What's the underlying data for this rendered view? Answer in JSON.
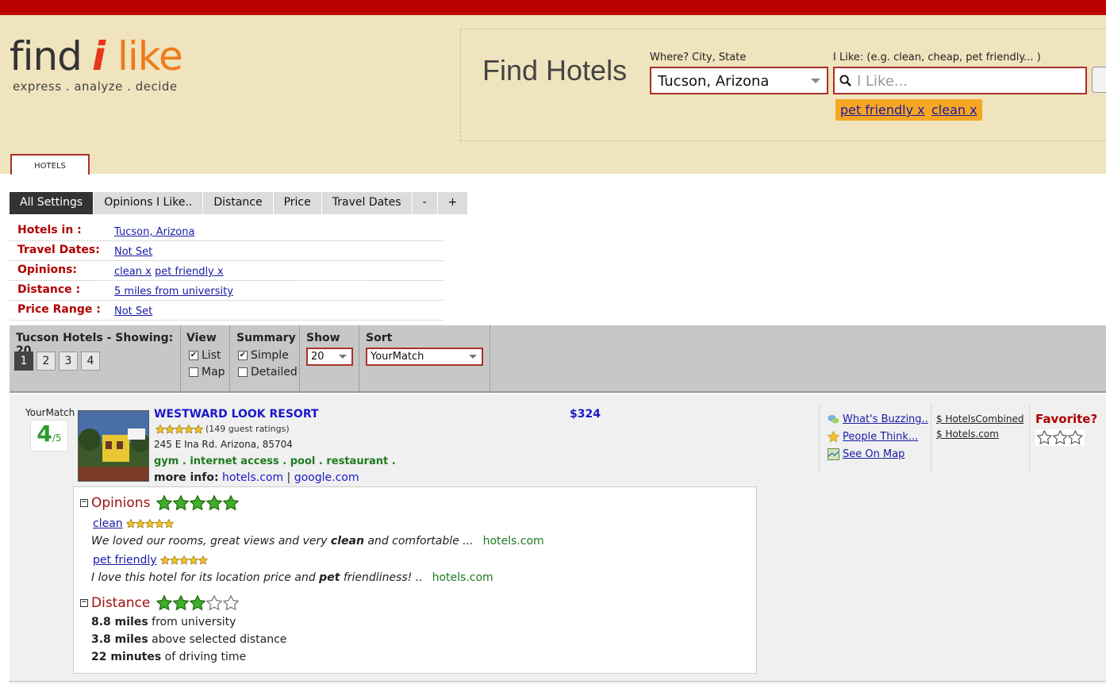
{
  "logo": {
    "part1": "find",
    "part2": "i",
    "part3": "like",
    "tagline": "express . analyze . decide"
  },
  "search": {
    "title": "Find Hotels",
    "where_label": "Where? City, State",
    "where_value": "Tucson, Arizona",
    "like_label": "I Like: (e.g. clean, cheap, pet friendly... )",
    "like_placeholder": "I Like...",
    "tags": [
      "pet friendly x",
      "clean x"
    ]
  },
  "main_tab": "HOTELS",
  "settings_tabs": [
    "All Settings",
    "Opinions I Like..",
    "Distance",
    "Price",
    "Travel Dates",
    "-",
    "+"
  ],
  "settings": [
    {
      "label": "Hotels in :",
      "value": "Tucson, Arizona"
    },
    {
      "label": "Travel Dates:",
      "value": "Not Set"
    },
    {
      "label": "Opinions:",
      "value": "clean x",
      "value2": "pet friendly x"
    },
    {
      "label": "Distance :",
      "value": "5 miles from university"
    },
    {
      "label": "Price Range :",
      "value": "Not Set"
    }
  ],
  "controls": {
    "showing": "Tucson Hotels - Showing: 20",
    "pages": [
      "1",
      "2",
      "3",
      "4"
    ],
    "current_page": "1",
    "view_label": "View",
    "view_options": [
      "List",
      "Map"
    ],
    "summary_label": "Summary",
    "summary_options": [
      "Simple",
      "Detailed"
    ],
    "show_label": "Show",
    "show_value": "20",
    "sort_label": "Sort",
    "sort_value": "YourMatch"
  },
  "hotel": {
    "yourmatch_label": "YourMatch",
    "score": "4",
    "score_max": "/5",
    "name": "WESTWARD LOOK RESORT",
    "ratings_text": "(149 guest ratings)",
    "guest_rating_stars": 4.5,
    "address": "245 E Ina Rd. Arizona, 85704",
    "amenities": "gym . internet access . pool . restaurant .",
    "more_info_label": "more info:",
    "more_link1": "hotels.com",
    "more_sep": "|",
    "more_link2": "google.com",
    "price": "$324",
    "side_links": [
      "What's Buzzing..",
      "People Think...",
      "See On Map"
    ],
    "price_links": [
      "$ HotelsCombined",
      "$ Hotels.com"
    ],
    "favorite_label": "Favorite?",
    "opinions_title": "Opinions",
    "opinions_stars": 5,
    "opinions": [
      {
        "term": "clean",
        "quote_pre": "We loved our rooms, great views and very ",
        "quote_bold": "clean",
        "quote_post": " and comfortable ...",
        "source": "hotels.com"
      },
      {
        "term": "pet friendly",
        "quote_pre": "I love this hotel for its location price and ",
        "quote_bold": "pet",
        "quote_post": " friendliness! ..",
        "source": "hotels.com"
      }
    ],
    "distance_title": "Distance",
    "distance_stars": 3,
    "distance_lines": [
      {
        "bold": "8.8 miles",
        "rest": " from university"
      },
      {
        "bold": "3.8 miles",
        "rest": " above selected distance"
      },
      {
        "bold": "22 minutes",
        "rest": " of driving time"
      }
    ]
  },
  "colors": {
    "topbar": "#bb0000",
    "header_bg": "#efe4bd",
    "accent_red": "#a83228",
    "tag_orange": "#f6a623",
    "star_green": "#3fae2a"
  }
}
